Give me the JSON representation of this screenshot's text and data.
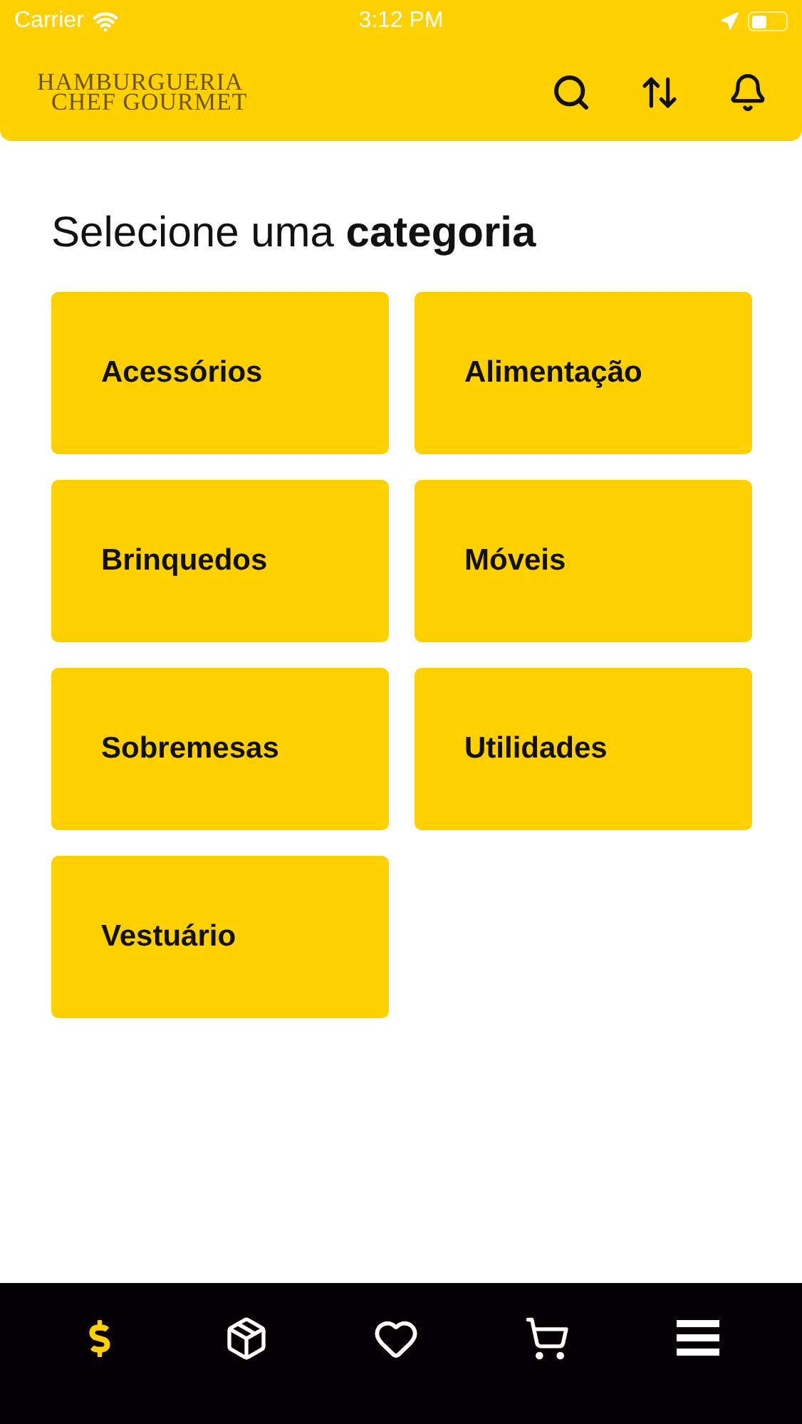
{
  "status_bar": {
    "carrier": "Carrier",
    "time": "3:12 PM"
  },
  "header": {
    "logo_lines": [
      "HAMBURGUERIA",
      "CHEF GOURMET"
    ]
  },
  "heading": "Selecione uma **categoria**",
  "categories": [
    {
      "label": "Acessórios"
    },
    {
      "label": "Alimentação"
    },
    {
      "label": "Brinquedos"
    },
    {
      "label": "Móveis"
    },
    {
      "label": "Sobremesas"
    },
    {
      "label": "Utilidades"
    },
    {
      "label": "Vestuário"
    }
  ],
  "tab_bar": [
    {
      "kind": "offers",
      "selected": true
    },
    {
      "kind": "orders",
      "selected": false
    },
    {
      "kind": "favorites",
      "selected": false
    },
    {
      "kind": "cart",
      "selected": false
    },
    {
      "kind": "menu",
      "selected": false
    }
  ]
}
